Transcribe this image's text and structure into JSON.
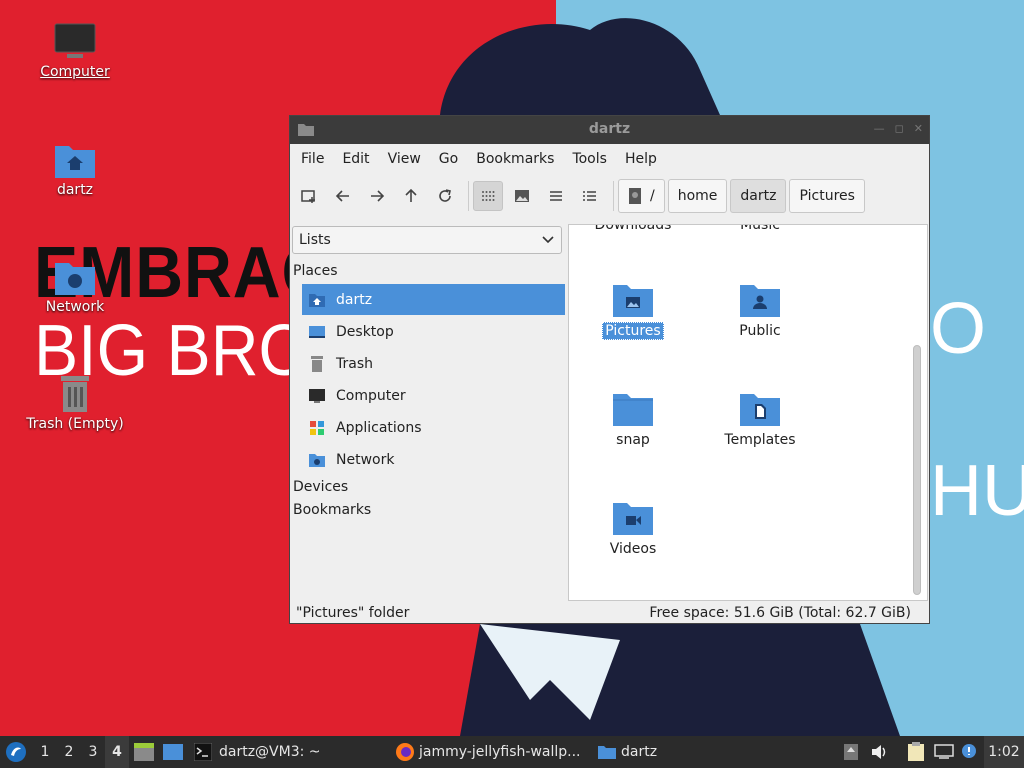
{
  "desktop": {
    "icons": [
      {
        "label": "Computer"
      },
      {
        "label": "dartz"
      },
      {
        "label": "Network"
      },
      {
        "label": "Trash (Empty)"
      }
    ],
    "wallpaper_text": {
      "line1": "EMBRACE",
      "line2": "BIG BROTH",
      "right1": "O",
      "right2": "HUD"
    }
  },
  "window": {
    "title": "dartz",
    "menu": [
      "File",
      "Edit",
      "View",
      "Go",
      "Bookmarks",
      "Tools",
      "Help"
    ],
    "breadcrumb": [
      "/",
      "home",
      "dartz",
      "Pictures"
    ],
    "sidebar": {
      "selector": "Lists",
      "places_header": "Places",
      "places": [
        "dartz",
        "Desktop",
        "Trash",
        "Computer",
        "Applications",
        "Network"
      ],
      "devices_header": "Devices",
      "bookmarks_header": "Bookmarks"
    },
    "files": {
      "partial_top": [
        "Downloads",
        "Music"
      ],
      "items": [
        "Pictures",
        "Public",
        "snap",
        "Templates",
        "Videos"
      ]
    },
    "status": {
      "left": "\"Pictures\" folder",
      "right": "Free space: 51.6 GiB (Total: 62.7 GiB)"
    }
  },
  "taskbar": {
    "workspaces": [
      "1",
      "2",
      "3",
      "4"
    ],
    "active_workspace": "4",
    "tasks": [
      "dartz@VM3: ~",
      "jammy-jellyfish-wallp...",
      "dartz"
    ],
    "clock": "1:02"
  },
  "colors": {
    "wallpaper_red": "#e0202e",
    "wallpaper_blue": "#7ec3e2",
    "folder_blue": "#4a90d9",
    "selection": "#4a90d9"
  }
}
